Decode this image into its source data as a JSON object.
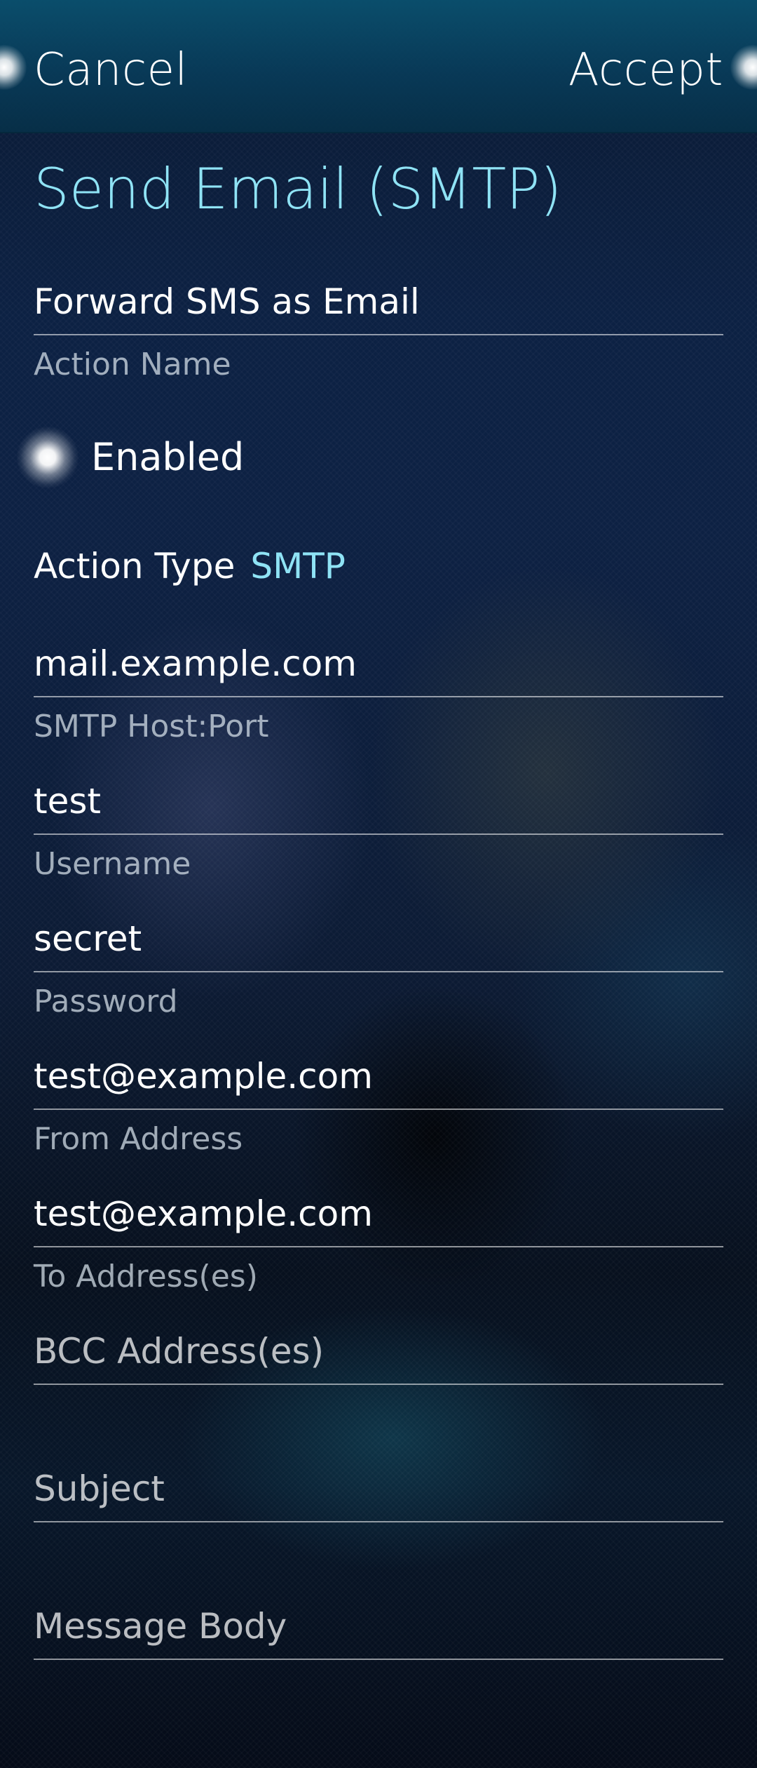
{
  "header": {
    "cancel_label": "Cancel",
    "accept_label": "Accept"
  },
  "page": {
    "title": "Send Email (SMTP)"
  },
  "action_name": {
    "value": "Forward SMS as Email",
    "label": "Action Name"
  },
  "enabled_switch": {
    "label": "Enabled",
    "checked": true
  },
  "action_type": {
    "label": "Action Type",
    "value": "SMTP"
  },
  "fields": {
    "smtp_host": {
      "value": "mail.example.com",
      "label": "SMTP Host:Port"
    },
    "username": {
      "value": "test",
      "label": "Username"
    },
    "password": {
      "value": "secret",
      "label": "Password"
    },
    "from_address": {
      "value": "test@example.com",
      "label": "From Address"
    },
    "to_address": {
      "value": "test@example.com",
      "label": "To Address(es)"
    },
    "bcc_address": {
      "placeholder": "BCC Address(es)"
    },
    "subject": {
      "placeholder": "Subject"
    },
    "message_body": {
      "placeholder": "Message Body"
    }
  },
  "colors": {
    "accent": "#8fe3f5",
    "header_bg": "#0a5070",
    "text_primary": "#ffffff",
    "text_secondary": "#c8d2dc"
  }
}
